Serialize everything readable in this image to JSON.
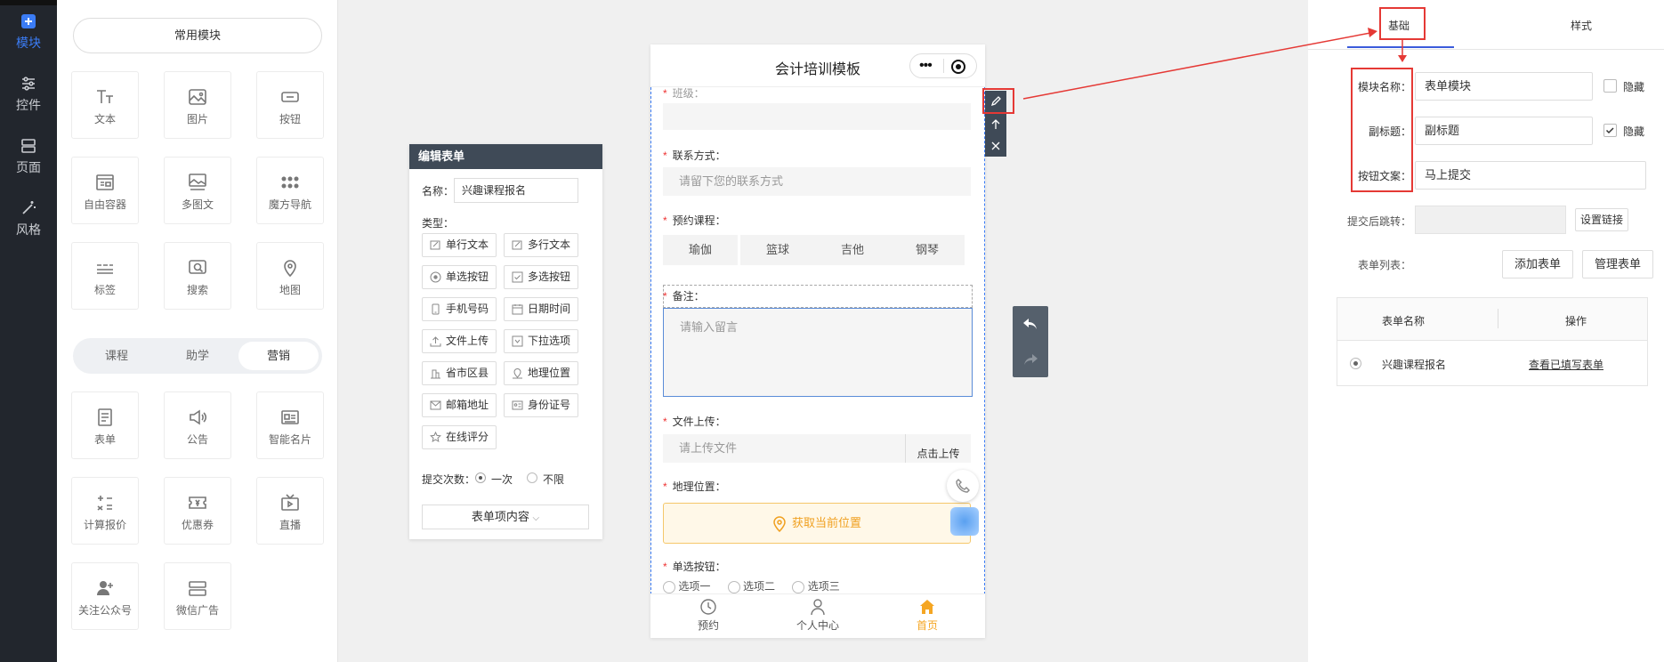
{
  "nav": {
    "items": [
      {
        "label": "模块"
      },
      {
        "label": "控件"
      },
      {
        "label": "页面"
      },
      {
        "label": "风格"
      }
    ]
  },
  "modules": {
    "common_label": "常用模块",
    "common": [
      {
        "label": "文本",
        "icon": "text-icon"
      },
      {
        "label": "图片",
        "icon": "image-icon"
      },
      {
        "label": "按钮",
        "icon": "button-icon"
      },
      {
        "label": "自由容器",
        "icon": "container-icon"
      },
      {
        "label": "多图文",
        "icon": "multi-image-icon"
      },
      {
        "label": "魔方导航",
        "icon": "grid-dots-icon"
      },
      {
        "label": "标签",
        "icon": "tag-icon"
      },
      {
        "label": "搜索",
        "icon": "search-icon"
      },
      {
        "label": "地图",
        "icon": "map-pin-icon"
      }
    ],
    "tabs": [
      {
        "label": "课程"
      },
      {
        "label": "助学"
      },
      {
        "label": "营销"
      }
    ],
    "marketing": [
      {
        "label": "表单",
        "icon": "form-icon"
      },
      {
        "label": "公告",
        "icon": "megaphone-icon"
      },
      {
        "label": "智能名片",
        "icon": "card-icon"
      },
      {
        "label": "计算报价",
        "icon": "calculator-icon"
      },
      {
        "label": "优惠券",
        "icon": "coupon-icon"
      },
      {
        "label": "直播",
        "icon": "live-icon"
      },
      {
        "label": "关注公众号",
        "icon": "follow-icon"
      },
      {
        "label": "微信广告",
        "icon": "ad-icon"
      }
    ]
  },
  "form_editor": {
    "header": "编辑表单",
    "name_label": "名称：",
    "name_value": "兴趣课程报名",
    "type_label": "类型：",
    "types": [
      {
        "label": "单行文本"
      },
      {
        "label": "多行文本"
      },
      {
        "label": "单选按钮"
      },
      {
        "label": "多选按钮"
      },
      {
        "label": "手机号码"
      },
      {
        "label": "日期时间"
      },
      {
        "label": "文件上传"
      },
      {
        "label": "下拉选项"
      },
      {
        "label": "省市区县"
      },
      {
        "label": "地理位置"
      },
      {
        "label": "邮箱地址"
      },
      {
        "label": "身份证号"
      },
      {
        "label": "在线评分"
      }
    ],
    "submit_label": "提交次数：",
    "submit_once": "一次",
    "submit_unlimited": "不限",
    "content_button": "表单项内容"
  },
  "phone": {
    "title": "会计培训模板",
    "class_label": "班级：",
    "contact_label": "联系方式：",
    "contact_placeholder": "请留下您的联系方式",
    "course_label": "预约课程：",
    "courses": [
      {
        "label": "瑜伽"
      },
      {
        "label": "篮球"
      },
      {
        "label": "吉他"
      },
      {
        "label": "钢琴"
      }
    ],
    "note_label": "备注：",
    "note_placeholder": "请输入留言",
    "upload_label": "文件上传：",
    "upload_placeholder": "请上传文件",
    "upload_button": "点击上传",
    "location_label": "地理位置：",
    "location_button": "获取当前位置",
    "radio_label": "单选按钮：",
    "radio_options": [
      {
        "label": "选项一"
      },
      {
        "label": "选项二"
      },
      {
        "label": "选项三"
      }
    ],
    "tabbar": [
      {
        "label": "预约"
      },
      {
        "label": "个人中心"
      },
      {
        "label": "首页"
      }
    ]
  },
  "settings": {
    "tabs": [
      {
        "label": "基础"
      },
      {
        "label": "样式"
      }
    ],
    "module_name_label": "模块名称：",
    "module_name_value": "表单模块",
    "hide_label": "隐藏",
    "subtitle_label": "副标题：",
    "subtitle_value": "副标题",
    "button_text_label": "按钮文案：",
    "button_text_value": "马上提交",
    "redirect_label": "提交后跳转：",
    "set_link": "设置链接",
    "form_list_label": "表单列表：",
    "add_form": "添加表单",
    "manage_form": "管理表单",
    "table_headers": [
      "表单名称",
      "操作"
    ],
    "table_rows": [
      {
        "name": "兴趣课程报名",
        "action": "查看已填写表单"
      }
    ]
  },
  "colors": {
    "accent": "#3b7cf5",
    "annotation": "#e53935",
    "tab_active": "#f5a623"
  }
}
